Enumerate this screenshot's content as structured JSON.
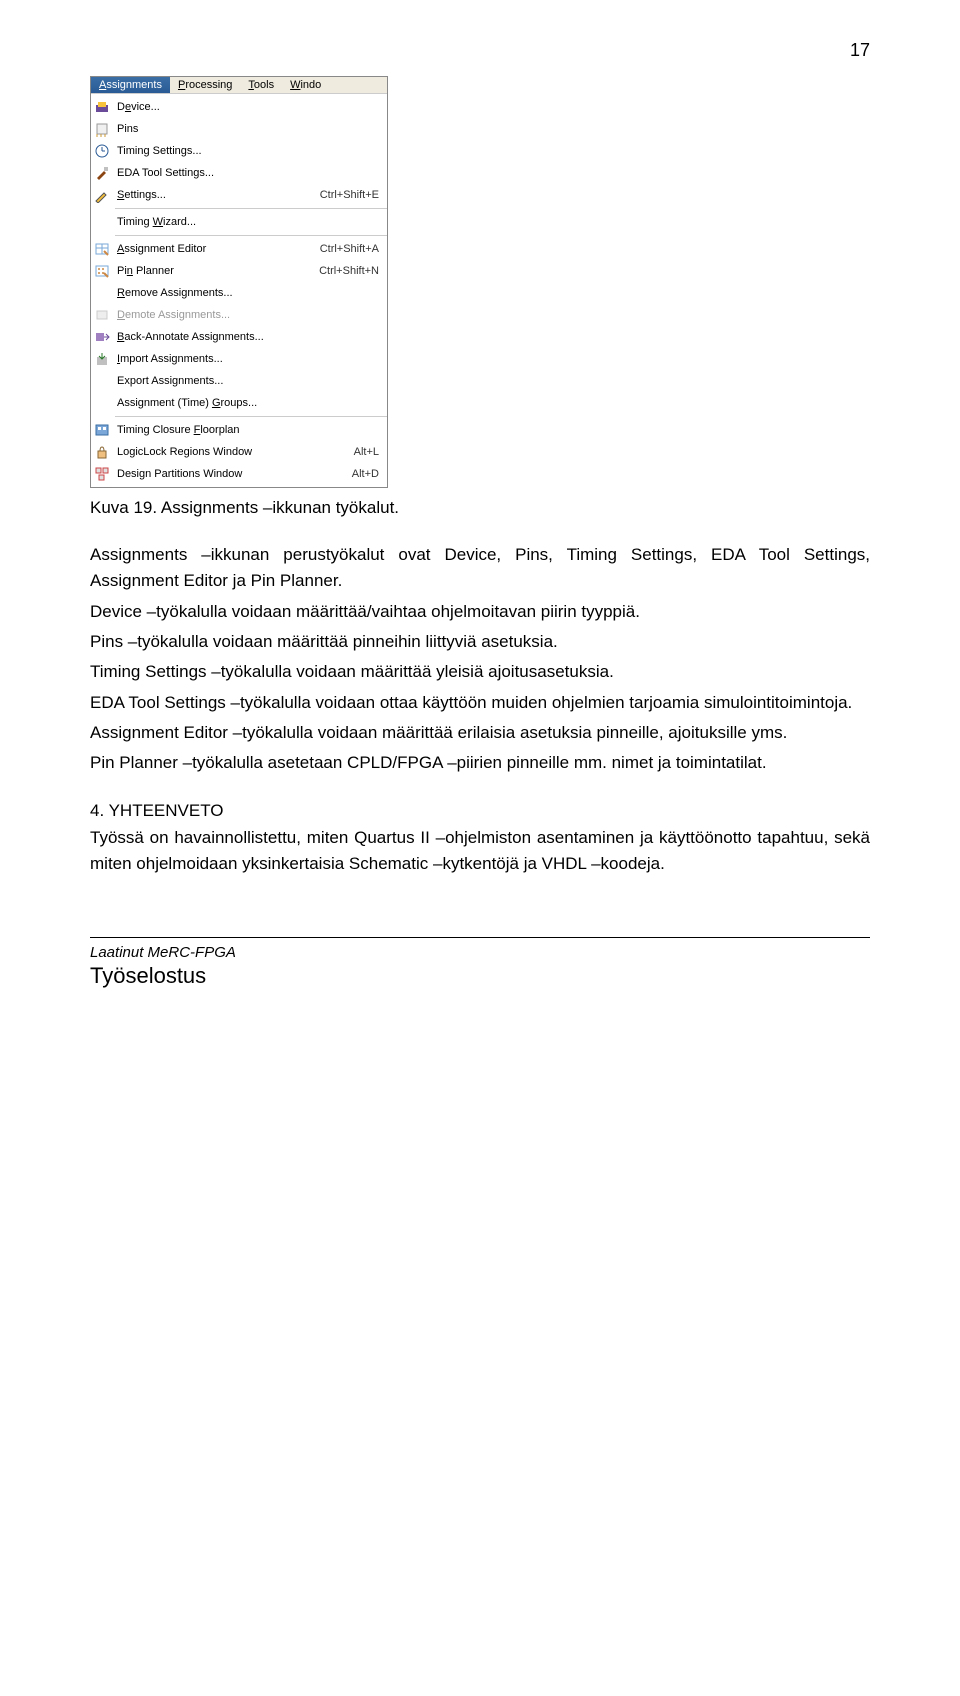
{
  "page_number": "17",
  "menubar": {
    "items": [
      {
        "label": "Assignments",
        "underline": "A",
        "active": true
      },
      {
        "label": "Processing",
        "underline": "P",
        "active": false
      },
      {
        "label": "Tools",
        "underline": "T",
        "active": false
      },
      {
        "label": "Window",
        "underline": "W",
        "active": false,
        "text": "Windo"
      }
    ]
  },
  "menu": {
    "group1": [
      {
        "name": "device",
        "label": "Device...",
        "ul": "e",
        "icon": "device"
      },
      {
        "name": "pins",
        "label": "Pins",
        "ul": "",
        "icon": "pins"
      },
      {
        "name": "timing-settings",
        "label": "Timing Settings...",
        "ul": "",
        "icon": "clock"
      },
      {
        "name": "eda-tool",
        "label": "EDA Tool Settings...",
        "ul": "",
        "icon": "tool"
      },
      {
        "name": "settings",
        "label": "Settings...",
        "ul": "S",
        "icon": "pencil",
        "shortcut": "Ctrl+Shift+E"
      }
    ],
    "group2": [
      {
        "name": "timing-wizard",
        "label": "Timing Wizard...",
        "ul": "W",
        "icon": ""
      }
    ],
    "group3": [
      {
        "name": "assignment-editor",
        "label": "Assignment Editor",
        "ul": "A",
        "icon": "grid",
        "shortcut": "Ctrl+Shift+A"
      },
      {
        "name": "pin-planner",
        "label": "Pin Planner",
        "ul": "n",
        "icon": "grid2",
        "shortcut": "Ctrl+Shift+N"
      },
      {
        "name": "remove-assignments",
        "label": "Remove Assignments...",
        "ul": "R",
        "icon": ""
      },
      {
        "name": "demote-assignments",
        "label": "Demote Assignments...",
        "ul": "D",
        "icon": "demote",
        "disabled": true
      },
      {
        "name": "back-annotate",
        "label": "Back-Annotate Assignments...",
        "ul": "B",
        "icon": "back"
      },
      {
        "name": "import-assignments",
        "label": "Import Assignments...",
        "ul": "I",
        "icon": "import"
      },
      {
        "name": "export-assignments",
        "label": "Export Assignments...",
        "ul": "",
        "icon": ""
      },
      {
        "name": "assignment-groups",
        "label": "Assignment (Time) Groups...",
        "ul": "G",
        "icon": ""
      }
    ],
    "group4": [
      {
        "name": "timing-closure",
        "label": "Timing Closure Floorplan",
        "ul": "F",
        "icon": "floorplan"
      },
      {
        "name": "logiclock",
        "label": "LogicLock Regions Window",
        "ul": "",
        "icon": "lock",
        "shortcut": "Alt+L"
      },
      {
        "name": "design-partitions",
        "label": "Design Partitions Window",
        "ul": "",
        "icon": "partition",
        "shortcut": "Alt+D"
      }
    ]
  },
  "caption": "Kuva 19. Assignments –ikkunan työkalut.",
  "paragraphs": {
    "p1": "Assignments –ikkunan perustyökalut ovat Device, Pins, Timing Settings, EDA Tool Settings, Assignment Editor ja Pin Planner.",
    "p2": "Device –työkalulla voidaan määrittää/vaihtaa ohjelmoitavan piirin tyyppiä.",
    "p3": "Pins –työkalulla voidaan määrittää pinneihin liittyviä asetuksia.",
    "p4": "Timing Settings –työkalulla voidaan määrittää yleisiä ajoitusasetuksia.",
    "p5": "EDA Tool Settings –työkalulla voidaan ottaa käyttöön muiden ohjelmien tarjoamia simulointitoimintoja.",
    "p6": "Assignment Editor –työkalulla voidaan määrittää erilaisia asetuksia pinneille, ajoituksille yms.",
    "p7": "Pin Planner –työkalulla asetetaan CPLD/FPGA –piirien pinneille mm. nimet ja toimintatilat."
  },
  "section_title": "4. YHTEENVETO",
  "summary": "Työssä on havainnollistettu, miten Quartus II –ohjelmiston asentaminen ja käyttöönotto tapahtuu, sekä miten ohjelmoidaan yksinkertaisia Schematic –kytkentöjä ja VHDL –koodeja.",
  "footer": {
    "author": "Laatinut MeRC-FPGA",
    "title": "Työselostus"
  },
  "icons": {
    "device": {
      "fill": "#f7c23c",
      "accent": "#6a4b9a"
    },
    "pins": {
      "fill": "#f0f0f0",
      "accent": "#cc9933"
    },
    "clock": {
      "fill": "#fff",
      "accent": "#2a5a95"
    },
    "tool": {
      "fill": "#c0c0c0",
      "accent": "#8b4513"
    },
    "pencil": {
      "fill": "#f7c23c",
      "accent": "#555"
    },
    "grid": {
      "fill": "#7aa7d8",
      "accent": "#c84"
    },
    "grid2": {
      "fill": "#7aa7d8",
      "accent": "#c84"
    },
    "demote": {
      "fill": "#ccc",
      "accent": "#999"
    },
    "back": {
      "fill": "#a080c0",
      "accent": "#6a4b9a"
    },
    "import": {
      "fill": "#c0c0c0",
      "accent": "#2a7a2a"
    },
    "floorplan": {
      "fill": "#7aa7d8",
      "accent": "#3a6ea5"
    },
    "lock": {
      "fill": "#f0c080",
      "accent": "#886633"
    },
    "partition": {
      "fill": "#e0e0e0",
      "accent": "#cc4444"
    }
  }
}
